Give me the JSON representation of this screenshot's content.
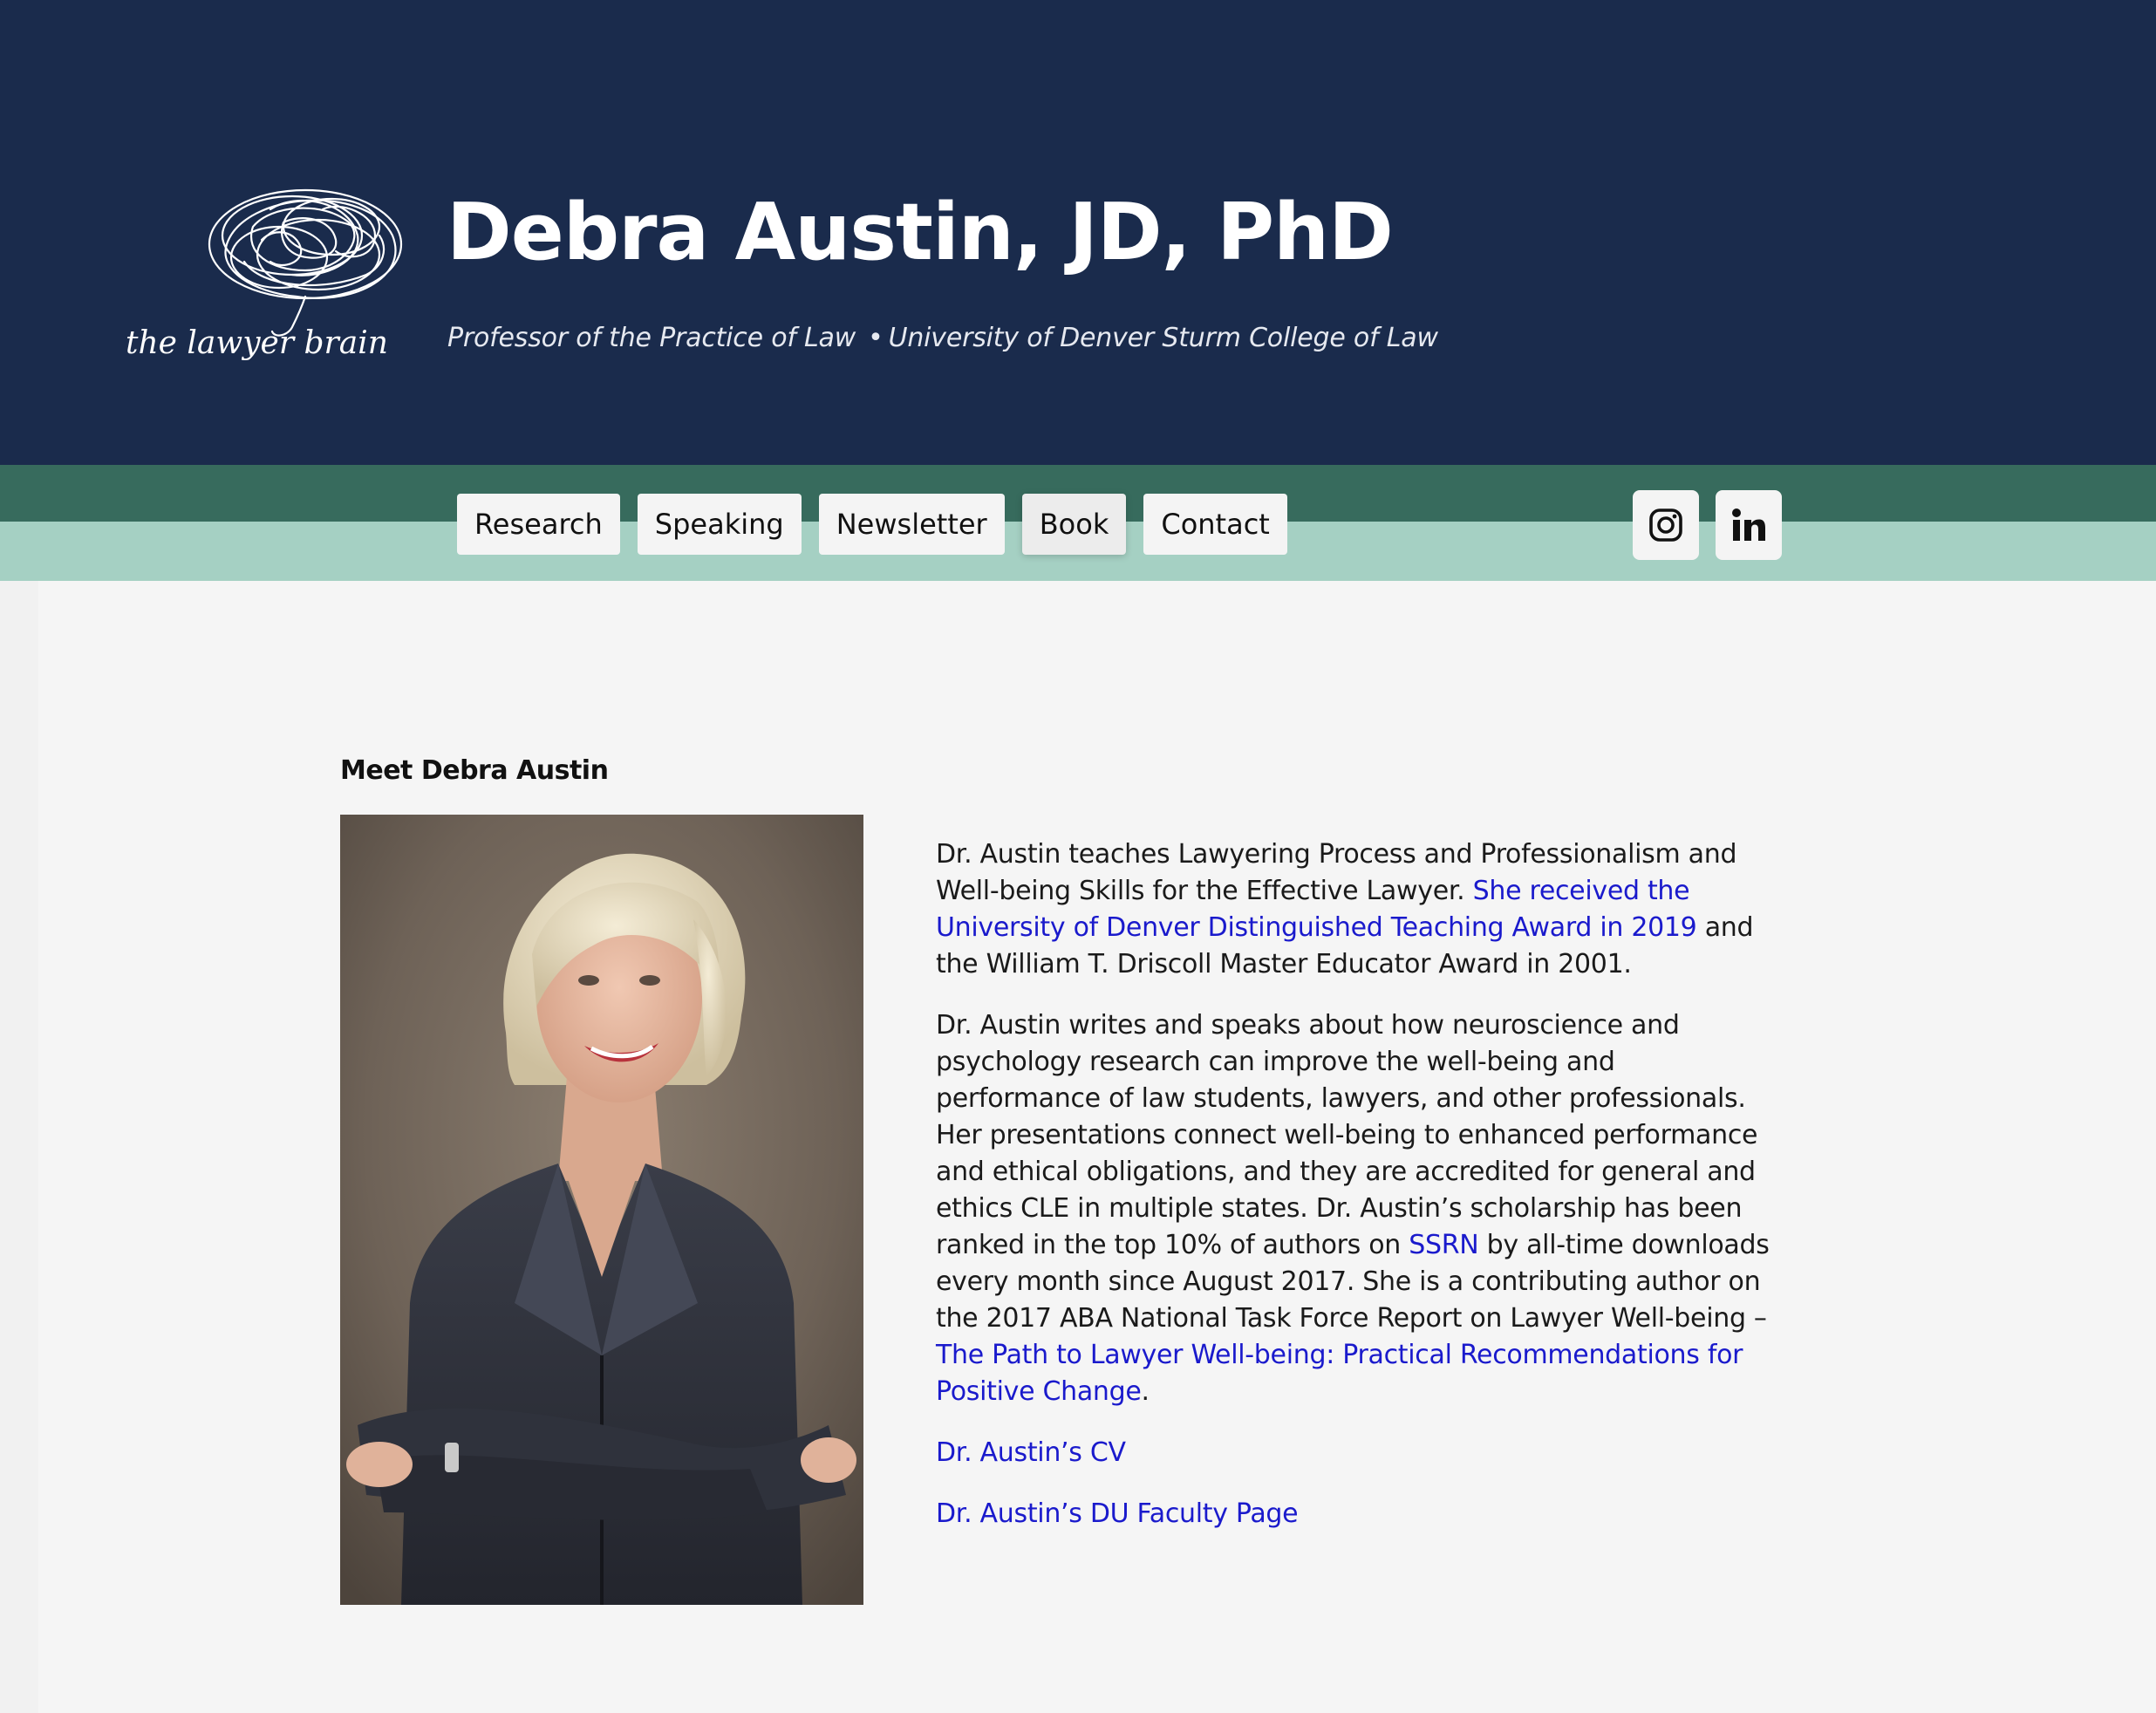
{
  "header": {
    "logo_text": "the lawyer brain",
    "title": "Debra Austin, JD, PhD",
    "subtitle_role": "Professor of the Practice of Law",
    "subtitle_separator": "•",
    "subtitle_institution": "University of Denver Sturm College of Law",
    "background_color": "#1a2b4c"
  },
  "nav": {
    "items": [
      {
        "label": "Research"
      },
      {
        "label": "Speaking"
      },
      {
        "label": "Newsletter"
      },
      {
        "label": "Book",
        "active": true
      },
      {
        "label": "Contact"
      }
    ],
    "social": [
      {
        "icon": "instagram-icon"
      },
      {
        "icon": "linkedin-icon"
      }
    ],
    "band_dark_color": "#376b5d",
    "band_light_color": "#a5d0c3"
  },
  "main": {
    "heading": "Meet Debra Austin",
    "portrait_alt": "Portrait of Debra Austin",
    "bio": {
      "p1": {
        "text_a": "Dr. Austin teaches Lawyering Process and Professionalism and Well-being Skills for the Effective Lawyer. ",
        "link_award": "She received the University of Denver Distinguished Teaching Award in 2019",
        "text_b": " and the William T. Driscoll Master Educator Award in 2001."
      },
      "p2": {
        "text_a": "Dr. Austin writes and speaks about how neuroscience and psychology research can improve the well-being and performance of law students, lawyers, and other professionals. Her presentations connect well-being to enhanced performance and ethical obligations, and they are accredited for general and ethics CLE in multiple states. Dr. Austin’s scholarship has been ranked in the top 10% of authors on ",
        "link_ssrn": "SSRN",
        "text_b": " by all-time downloads every month since August 2017. She is a contributing author on the 2017 ABA National Task Force Report on Lawyer Well-being – ",
        "link_report": "The Path to Lawyer Well-being: Practical Recommendations for Positive Change",
        "text_c": "."
      },
      "link_cv": "Dr. Austin’s CV",
      "link_faculty": "Dr. Austin’s DU Faculty Page"
    },
    "link_color": "#1a1acc"
  }
}
